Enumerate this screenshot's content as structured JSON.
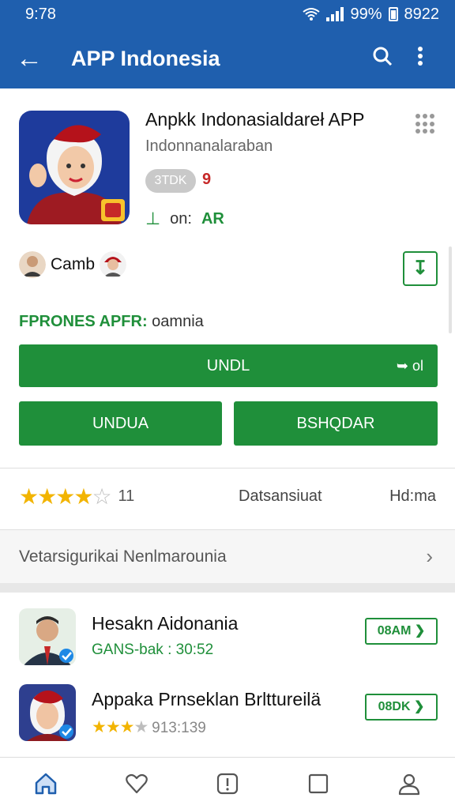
{
  "status": {
    "time": "9:78",
    "battery": "99%",
    "clock": "8922"
  },
  "appbar": {
    "title": "APP Indonesia",
    "back_icon": "arrow-left-icon",
    "search_icon": "search-icon",
    "menu_icon": "more-vertical-icon"
  },
  "app": {
    "title": "Anpkk Indonasialdareł APP",
    "subtitle": "Indonnanalaraban",
    "size_badge": "3TDK",
    "badge_number": "9",
    "install_icon": "install-icon",
    "install_label": "on:",
    "install_value": "AR",
    "developer": "Camb",
    "phones_label": "FPRONES APFR:",
    "phones_value": "oamnia"
  },
  "buttons": {
    "primary": "UNDL",
    "primary_side": "ol",
    "secondary_a": "UNDUA",
    "secondary_b": "BSHQDAR"
  },
  "rating": {
    "stars": 4,
    "count": "11",
    "middle": "Datsansiuat",
    "end": "Hd:ma"
  },
  "section": {
    "label": "Vetarsigurikai Nenlmarounia"
  },
  "list": [
    {
      "name": "Hesakn Aidonania",
      "meta": "GANS-bak : 30:52",
      "action": "08AM"
    },
    {
      "name": "Appaka Prnseklan Brlttureilä",
      "meta": "913:139",
      "stars": 2.5,
      "action": "08DK"
    }
  ],
  "bottom_nav": [
    "home-icon",
    "heart-icon",
    "alert-icon",
    "square-icon",
    "person-icon"
  ],
  "colors": {
    "primary": "#1f5fae",
    "accent_green": "#1f8f3a",
    "star": "#f2b400"
  }
}
